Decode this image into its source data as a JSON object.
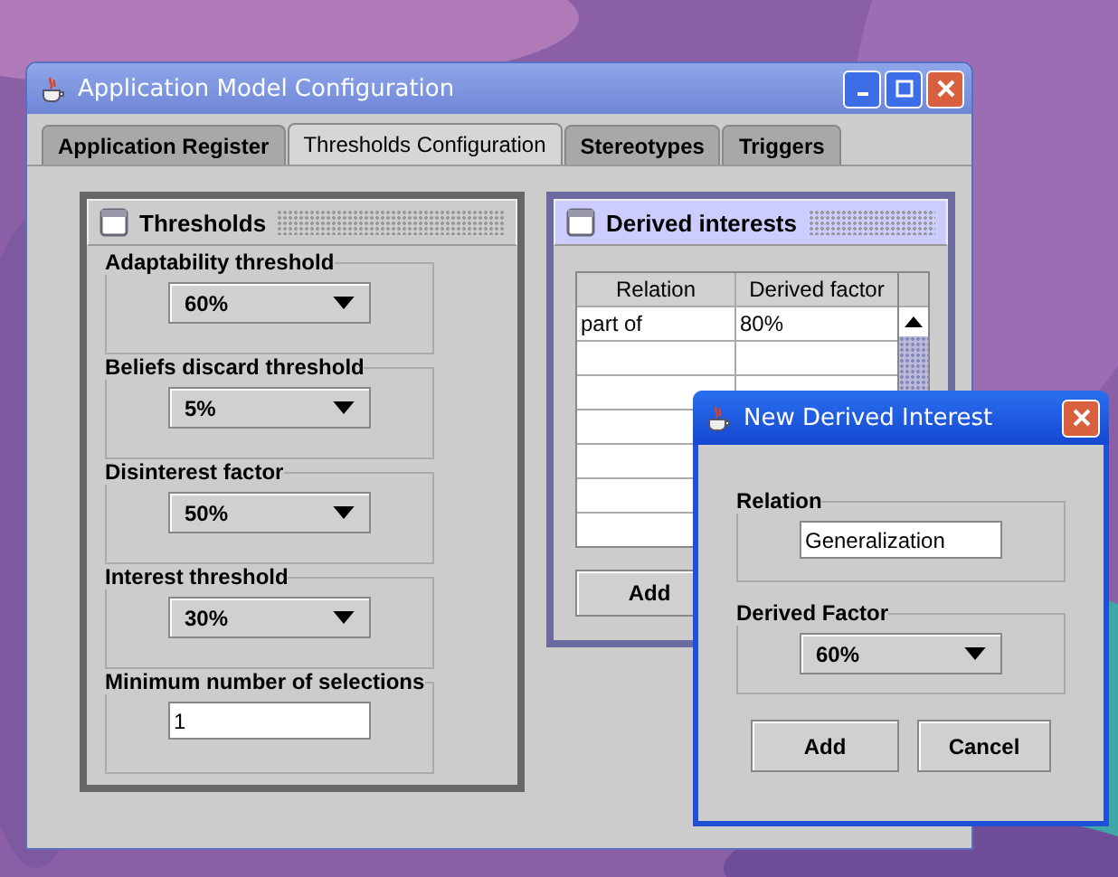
{
  "window": {
    "title": "Application Model Configuration"
  },
  "tabs": [
    {
      "label": "Application Register",
      "selected": false
    },
    {
      "label": "Thresholds Configuration",
      "selected": true
    },
    {
      "label": "Stereotypes",
      "selected": false
    },
    {
      "label": "Triggers",
      "selected": false
    }
  ],
  "thresholds_panel": {
    "title": "Thresholds",
    "fields": [
      {
        "kind": "dropdown",
        "label": "Adaptability threshold",
        "value": "60%"
      },
      {
        "kind": "dropdown",
        "label": "Beliefs discard threshold",
        "value": "5%"
      },
      {
        "kind": "dropdown",
        "label": "Disinterest factor",
        "value": "50%"
      },
      {
        "kind": "dropdown",
        "label": "Interest threshold",
        "value": "30%"
      },
      {
        "kind": "text",
        "label": "Minimum number of selections",
        "value": "1"
      }
    ]
  },
  "derived_panel": {
    "title": "Derived interests",
    "table": {
      "columns": [
        "Relation",
        "Derived factor"
      ],
      "rows": [
        [
          "part of",
          "80%"
        ]
      ]
    },
    "button": "Add"
  },
  "dialog": {
    "title": "New Derived Interest",
    "fields": [
      {
        "kind": "text",
        "label": "Relation",
        "value": "Generalization"
      },
      {
        "kind": "dropdown",
        "label": "Derived Factor",
        "value": "60%"
      }
    ],
    "buttons": [
      "Add",
      "Cancel"
    ]
  }
}
